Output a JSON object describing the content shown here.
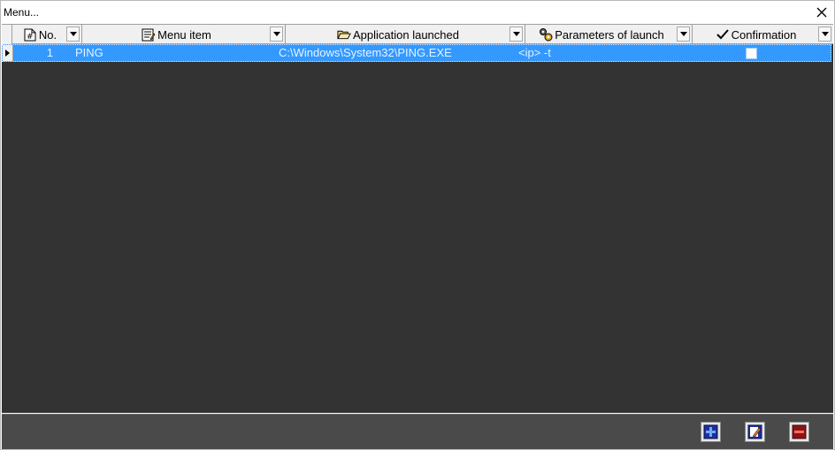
{
  "window": {
    "title": "Menu..."
  },
  "columns": [
    {
      "key": "no",
      "label": "No.",
      "icon": "hash-document-icon"
    },
    {
      "key": "menu_item",
      "label": "Menu item",
      "icon": "menu-document-icon"
    },
    {
      "key": "application",
      "label": "Application launched",
      "icon": "open-folder-icon"
    },
    {
      "key": "parameters",
      "label": "Parameters of launch",
      "icon": "gears-icon"
    },
    {
      "key": "confirmation",
      "label": "Confirmation",
      "icon": "checkmark-icon"
    }
  ],
  "rows": [
    {
      "no": "1",
      "menu_item": "PING",
      "application": "C:\\Windows\\System32\\PING.EXE",
      "parameters": "<ip> -t",
      "confirmation": false
    }
  ],
  "footer": {
    "buttons": [
      {
        "name": "add",
        "icon": "add-record-icon"
      },
      {
        "name": "edit",
        "icon": "edit-record-icon"
      },
      {
        "name": "delete",
        "icon": "delete-record-icon"
      }
    ]
  },
  "colors": {
    "grid_background": "#333333",
    "selection": "#3399ff",
    "footer": "#4a4a4a"
  }
}
